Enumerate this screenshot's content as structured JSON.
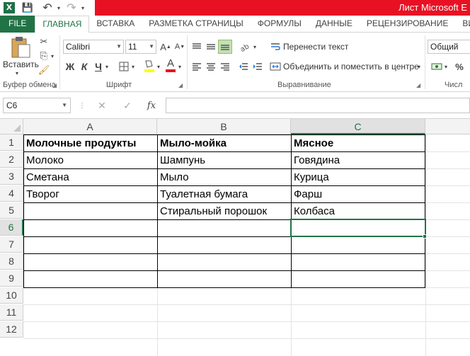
{
  "window": {
    "title": "Лист Microsoft E"
  },
  "quick_access": {
    "logo": "X",
    "save": "💾",
    "undo": "↶",
    "redo": "↷"
  },
  "ribbon_tabs": [
    {
      "label": "FILE"
    },
    {
      "label": "ГЛАВНАЯ"
    },
    {
      "label": "ВСТАВКА"
    },
    {
      "label": "РАЗМЕТКА СТРАНИЦЫ"
    },
    {
      "label": "ФОРМУЛЫ"
    },
    {
      "label": "ДАННЫЕ"
    },
    {
      "label": "РЕЦЕНЗИРОВАНИЕ"
    },
    {
      "label": "ВИД"
    }
  ],
  "clipboard": {
    "paste_label": "Вставить",
    "group_label": "Буфер обмена"
  },
  "font": {
    "name": "Calibri",
    "size": "11",
    "bold": "Ж",
    "italic": "К",
    "underline": "Ч",
    "grow": "A",
    "shrink": "A",
    "font_color_letter": "A",
    "group_label": "Шрифт"
  },
  "alignment": {
    "wrap_text": "Перенести текст",
    "merge_center": "Объединить и поместить в центре",
    "group_label": "Выравнивание"
  },
  "number": {
    "format": "Общий",
    "group_label": "Числ"
  },
  "formula_bar": {
    "name_box": "C6",
    "fx": "fx",
    "cancel": "✕",
    "enter": "✓",
    "content": ""
  },
  "columns": [
    "A",
    "B",
    "C"
  ],
  "rows": [
    "1",
    "2",
    "3",
    "4",
    "5",
    "6",
    "7",
    "8",
    "9",
    "10",
    "11",
    "12"
  ],
  "selected_cell": "C6",
  "sheet": {
    "headers": [
      "Молочные продукты",
      "Мыло-мойка",
      "Мясное"
    ],
    "data": [
      [
        "Молоко",
        "Шампунь",
        "Говядина"
      ],
      [
        "Сметана",
        "Мыло",
        "Курица"
      ],
      [
        "Творог",
        "Туалетная бумага",
        "Фарш"
      ],
      [
        "",
        "Стиральный порошок",
        "Колбаса"
      ]
    ]
  },
  "colors": {
    "excel_green": "#217346",
    "title_red": "#e81123",
    "header_bg": "#f3f3f3"
  }
}
